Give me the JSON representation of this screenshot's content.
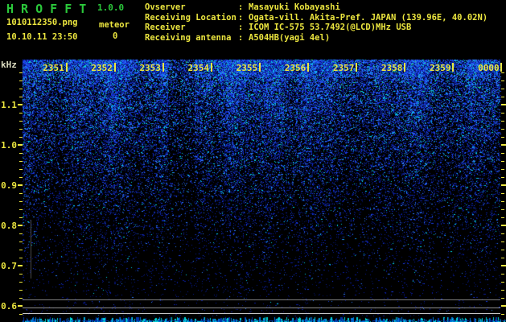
{
  "app": {
    "title": "H R O F F T",
    "version": "1.0.0",
    "filename": "1010112350.png",
    "mode_label": "meteor",
    "meteor_count": "0",
    "datetime": "10.10.11 23:50"
  },
  "station_info": {
    "rows": [
      {
        "label": "Ovserver",
        "value": "Masayuki Kobayashi"
      },
      {
        "label": "Receiving Location",
        "value": "Ogata-vill. Akita-Pref. JAPAN (139.96E, 40.02N)"
      },
      {
        "label": "Receiver",
        "value": "ICOM IC-575 53.7492(@LCD)MHz USB"
      },
      {
        "label": "Receiving antenna",
        "value": "A504HB(yagi 4el)"
      }
    ]
  },
  "spectrogram": {
    "freq_unit": "kHz",
    "freq_tick_labels": [
      "1.1",
      "1.0",
      "0.9",
      "0.8",
      "0.7",
      "0.6"
    ],
    "time_labels": [
      "2351",
      "2352",
      "2353",
      "2354",
      "2355",
      "2356",
      "2357",
      "2358",
      "2359",
      "0000"
    ],
    "carrier_lines_khz": [
      0.616,
      0.596,
      0.582
    ]
  },
  "colors": {
    "text_yellow": "#ece63f",
    "text_green": "#2bc83b",
    "khz_label": "#dcdcc0",
    "carrier_grays": [
      "#7d7d7d",
      "#8f8f8f",
      "#c6c6c6"
    ],
    "noise_palette": [
      "#041262",
      "#0a1d9e",
      "#1a3ce8",
      "#2e7bff",
      "#00d8e8",
      "#2fe55f"
    ],
    "strip_cyan": "#00d8d8",
    "strip_blue_bright": "#0077dd",
    "strip_blue_dark": "#0033aa"
  }
}
